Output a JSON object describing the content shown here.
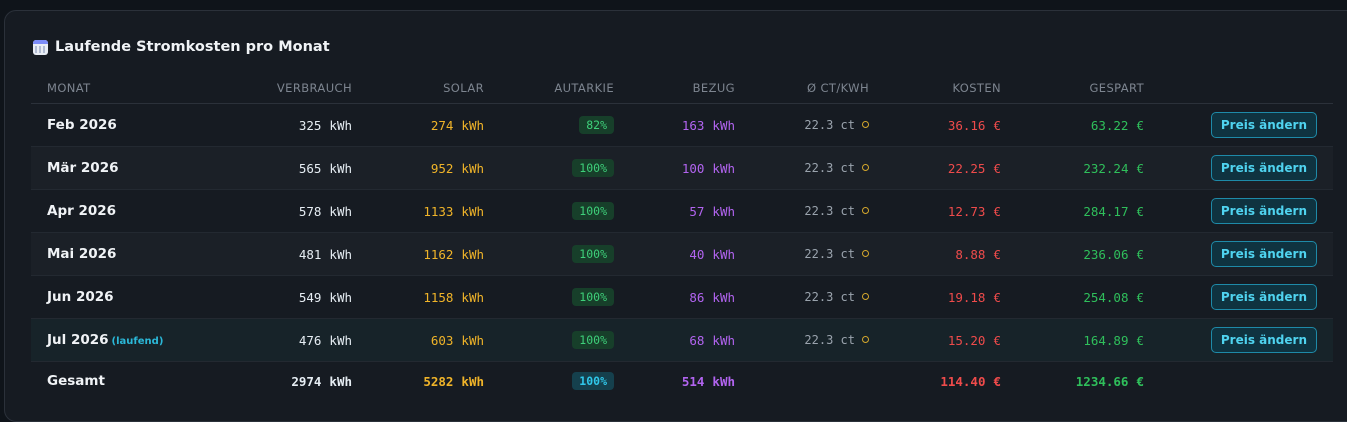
{
  "panel": {
    "title": "Laufende Stromkosten pro Monat",
    "icon": "calendar-icon"
  },
  "columns": {
    "monat": "MONAT",
    "verbrauch": "VERBRAUCH",
    "solar": "SOLAR",
    "autarkie": "AUTARKIE",
    "bezug": "BEZUG",
    "ct": "Ø CT/KWH",
    "kosten": "KOSTEN",
    "gespart": "GESPART"
  },
  "units": {
    "kwh": "kWh",
    "ct": "ct",
    "eur": "€"
  },
  "action_label": "Preis ändern",
  "rows": [
    {
      "month": "Feb 2026",
      "verbrauch": "325",
      "solar": "274",
      "autarkie": "82%",
      "bezug": "163",
      "ct": "22.3",
      "kosten": "36.16",
      "gespart": "63.22"
    },
    {
      "month": "Mär 2026",
      "verbrauch": "565",
      "solar": "952",
      "autarkie": "100%",
      "bezug": "100",
      "ct": "22.3",
      "kosten": "22.25",
      "gespart": "232.24"
    },
    {
      "month": "Apr 2026",
      "verbrauch": "578",
      "solar": "1133",
      "autarkie": "100%",
      "bezug": "57",
      "ct": "22.3",
      "kosten": "12.73",
      "gespart": "284.17"
    },
    {
      "month": "Mai 2026",
      "verbrauch": "481",
      "solar": "1162",
      "autarkie": "100%",
      "bezug": "40",
      "ct": "22.3",
      "kosten": "8.88",
      "gespart": "236.06"
    },
    {
      "month": "Jun 2026",
      "verbrauch": "549",
      "solar": "1158",
      "autarkie": "100%",
      "bezug": "86",
      "ct": "22.3",
      "kosten": "19.18",
      "gespart": "254.08"
    },
    {
      "month": "Jul 2026",
      "tag": "(laufend)",
      "verbrauch": "476",
      "solar": "603",
      "autarkie": "100%",
      "bezug": "68",
      "ct": "22.3",
      "kosten": "15.20",
      "gespart": "164.89"
    }
  ],
  "total": {
    "label": "Gesamt",
    "verbrauch": "2974",
    "solar": "5282",
    "autarkie": "100%",
    "bezug": "514",
    "kosten": "114.40",
    "gespart": "1234.66"
  },
  "colors": {
    "solar": "#f0b429",
    "bezug": "#b264f0",
    "kosten": "#ef4b4b",
    "gespart": "#2fbf5b",
    "accent": "#2bb8d8"
  }
}
